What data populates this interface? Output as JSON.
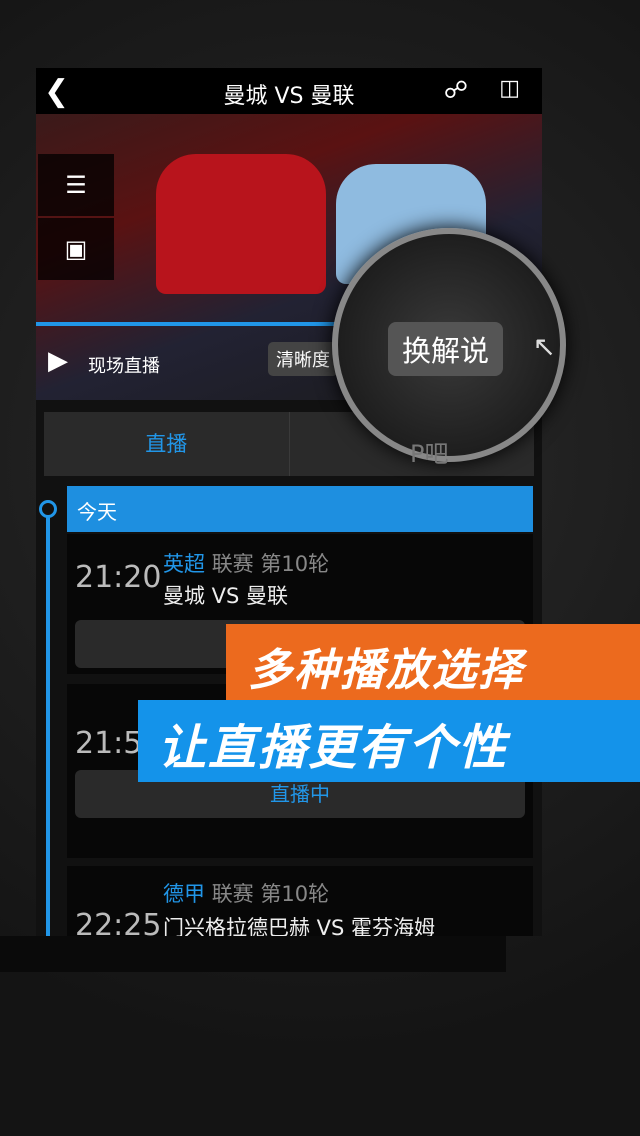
{
  "header": {
    "back_icon": "chevron-left-icon",
    "title": "曼城 VS 曼联",
    "share_icon": "share-icon",
    "device_icon": "device-switch-icon"
  },
  "player": {
    "menu_icon": "list-icon",
    "comment_icon": "comment-icon",
    "play_icon": "play-icon",
    "live_label": "现场直播",
    "quality_label": "清晰度",
    "commentary_label": "换解说",
    "progress": 0.59
  },
  "tabs": [
    {
      "label": "直播",
      "active": true
    },
    {
      "label": "P吧",
      "active": false
    }
  ],
  "today_label": "今天",
  "matches": [
    {
      "time": "21:20",
      "league": "英超",
      "round": "联赛 第10轮",
      "teams": "曼城  VS  曼联"
    },
    {
      "time": "21:5",
      "status": "直播中"
    },
    {
      "time": "22:25",
      "league": "德甲",
      "round": "联赛 第10轮",
      "teams": "门兴格拉德巴赫  VS  霍芬海姆"
    }
  ],
  "promo": {
    "line1": "多种播放选择",
    "line2": "让直播更有个性",
    "colors": {
      "orange": "#ec6a1e",
      "blue": "#1493ea"
    }
  }
}
